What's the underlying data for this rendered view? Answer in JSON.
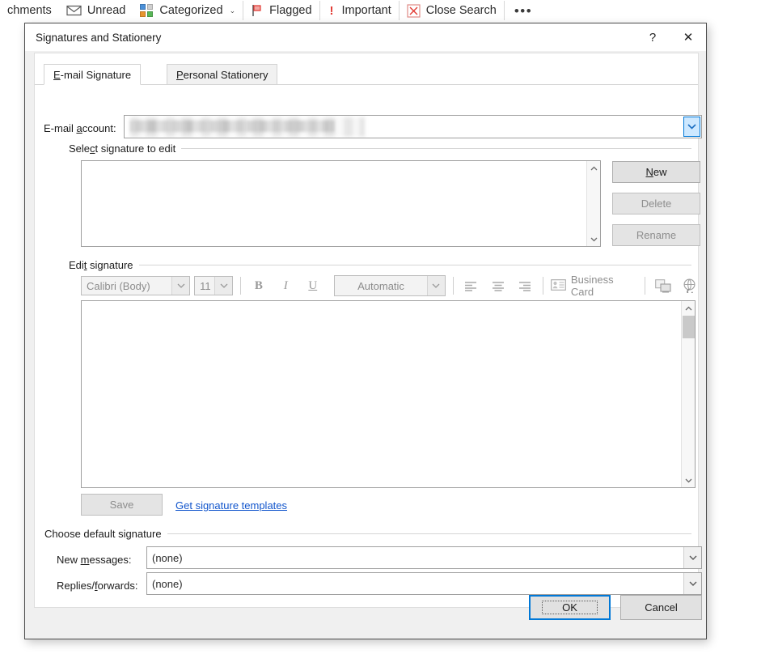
{
  "ribbon": {
    "items": [
      {
        "label": "chments",
        "icon": ""
      },
      {
        "label": "Unread",
        "icon": "envelope-icon"
      },
      {
        "label": "Categorized",
        "icon": "categories-icon",
        "chevron": "⌄"
      },
      {
        "label": "Flagged",
        "icon": "flag-icon"
      },
      {
        "label": "Important",
        "icon": "exclamation-icon"
      },
      {
        "label": "Close Search",
        "icon": "close-search-icon"
      }
    ],
    "overflow": "•••"
  },
  "dialog": {
    "title": "Signatures and Stationery",
    "help_label": "?",
    "close_label": "✕",
    "tabs": [
      {
        "label_pre": "E",
        "label_accel": "-",
        "label": "E-mail Signature",
        "accel": "E",
        "active": true
      },
      {
        "label": "Personal Stationery",
        "accel": "P",
        "active": false
      }
    ],
    "email_account": {
      "label": "E-mail account:",
      "accel": "a",
      "value": "",
      "redacted": true
    },
    "select_signature": {
      "group_label": "Select signature to edit",
      "accel": "c",
      "items": [],
      "buttons": [
        {
          "label": "New",
          "accel": "N",
          "enabled": true
        },
        {
          "label": "Delete",
          "enabled": false
        },
        {
          "label": "Rename",
          "enabled": false
        }
      ]
    },
    "edit_signature": {
      "group_label": "Edit signature",
      "accel": "t",
      "toolbar": {
        "font_family": "Calibri (Body)",
        "font_size": "11",
        "bold": "B",
        "italic": "I",
        "underline": "U",
        "color": "Automatic",
        "align_left": "align-left",
        "align_center": "align-center",
        "align_right": "align-right",
        "business_card": "Business Card",
        "insert_picture": "insert-picture",
        "insert_hyperlink": "insert-hyperlink"
      },
      "content": "",
      "save_label": "Save",
      "save_enabled": false,
      "templates_link": "Get signature templates"
    },
    "default_signature": {
      "group_label": "Choose default signature",
      "rows": [
        {
          "label": "New messages:",
          "accel": "m",
          "value": "(none)"
        },
        {
          "label": "Replies/forwards:",
          "accel": "f",
          "value": "(none)"
        }
      ]
    },
    "footer": {
      "ok_label": "OK",
      "cancel_label": "Cancel"
    }
  },
  "colors": {
    "accent": "#0078d7",
    "link": "#1155cc",
    "danger": "#e23b34"
  }
}
